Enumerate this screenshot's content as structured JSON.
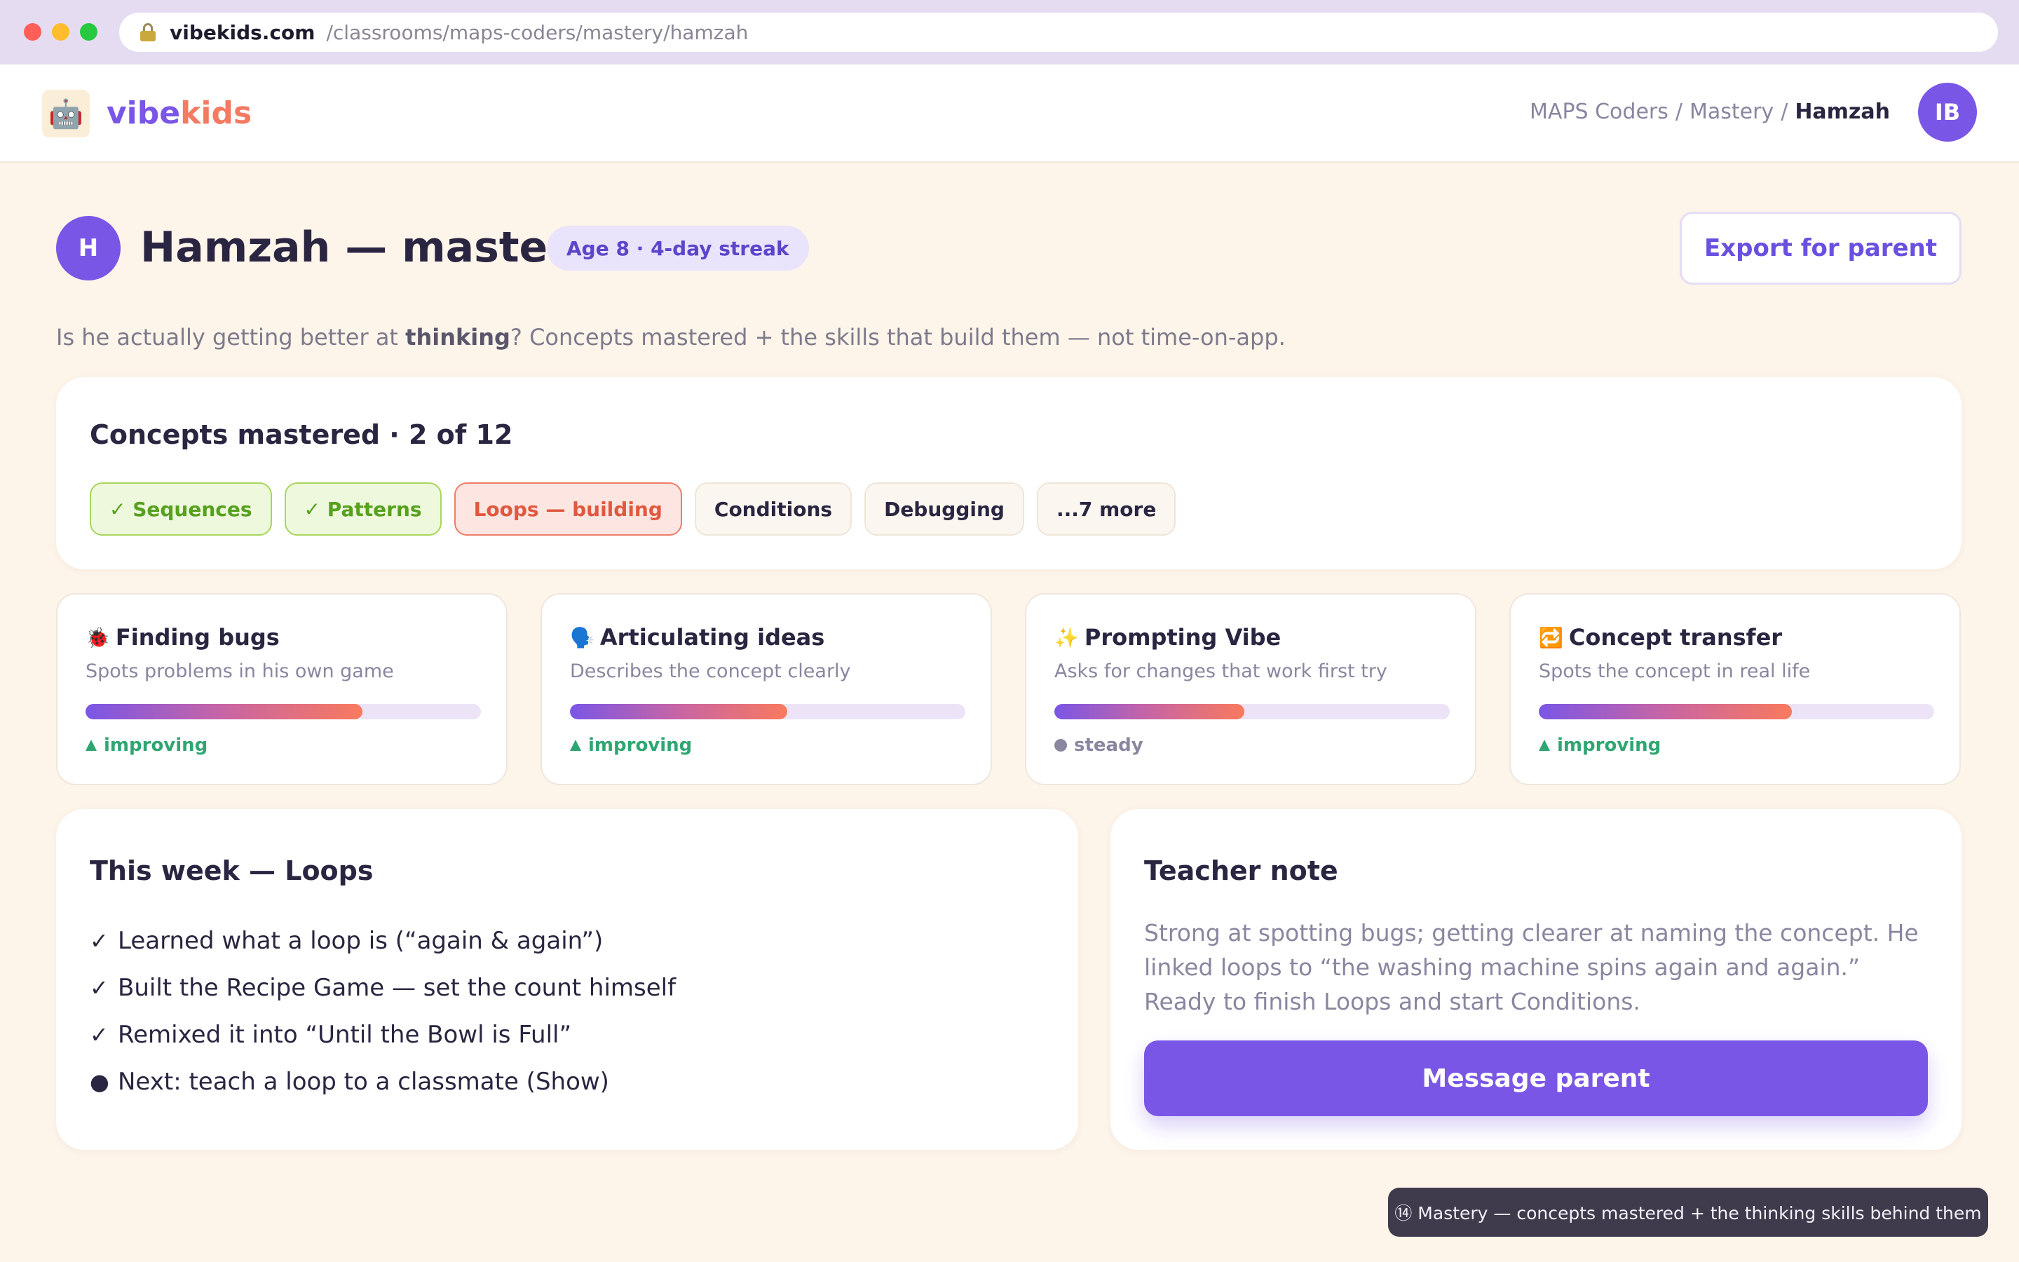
{
  "browser": {
    "host": "vibekids.com",
    "path": "/classrooms/maps-coders/mastery/hamzah"
  },
  "brand": {
    "part1": "vibe",
    "part2": "kids",
    "logo_icon": "kids-robot-logo"
  },
  "breadcrumb": {
    "items": [
      "MAPS Coders",
      "Mastery"
    ],
    "separator": "/",
    "current": "Hamzah"
  },
  "user": {
    "initials": "IB"
  },
  "student": {
    "initial": "H"
  },
  "page": {
    "title": "Hamzah — mastery",
    "meta": "Age 8 · 4-day streak",
    "export_label": "Export for parent",
    "subtitle_before": "Is he actually getting better at ",
    "subtitle_bold": "thinking",
    "subtitle_after": "? Concepts mastered + the skills that build them — not time-on-app."
  },
  "concepts": {
    "title": "Concepts mastered · 2 of 12",
    "chips": [
      {
        "label": "✓ Sequences",
        "state": "mastered"
      },
      {
        "label": "✓ Patterns",
        "state": "mastered"
      },
      {
        "label": "Loops — building",
        "state": "building"
      },
      {
        "label": "Conditions",
        "state": "locked"
      },
      {
        "label": "Debugging",
        "state": "locked"
      },
      {
        "label": "...7 more",
        "state": "more"
      }
    ]
  },
  "skills": [
    {
      "emoji": "🐞",
      "icon": "ladybug-icon",
      "title": "Finding bugs",
      "desc": "Spots problems in his own game",
      "progress": 0.7,
      "trend": "improving",
      "trend_dir": "up"
    },
    {
      "emoji": "🗣️",
      "icon": "speaking-head-icon",
      "title": "Articulating ideas",
      "desc": "Describes the concept clearly",
      "progress": 0.55,
      "trend": "improving",
      "trend_dir": "up"
    },
    {
      "emoji": "✨",
      "icon": "sparkles-icon",
      "title": "Prompting Vibe",
      "desc": "Asks for changes that work first try",
      "progress": 0.48,
      "trend": "steady",
      "trend_dir": "flat"
    },
    {
      "emoji": "🔁",
      "icon": "repeat-icon",
      "title": "Concept transfer",
      "desc": "Spots the concept in real life",
      "progress": 0.64,
      "trend": "improving",
      "trend_dir": "up"
    }
  ],
  "week": {
    "title": "This week — Loops",
    "items": [
      {
        "mark": "✓",
        "text": "Learned what a loop is (“again & again”)"
      },
      {
        "mark": "✓",
        "text": "Built the Recipe Game — set the count himself"
      },
      {
        "mark": "✓",
        "text": "Remixed it into “Until the Bowl is Full”"
      },
      {
        "mark": "●",
        "text": "Next: teach a loop to a classmate (Show)"
      }
    ]
  },
  "teacher_note": {
    "title": "Teacher note",
    "text": "Strong at spotting bugs; getting clearer at naming the concept. He linked loops to “the washing machine spins again and again.” Ready to finish Loops and start Conditions.",
    "button_label": "Message parent"
  },
  "caption": "⑭ Mastery — concepts mastered + the thinking skills behind them",
  "colors": {
    "accent": "#7a56e6",
    "coral": "#f47a62",
    "mastered": "#56a11e",
    "building": "#e0583f",
    "improving": "#2fa672",
    "background": "#fdf4ea"
  }
}
